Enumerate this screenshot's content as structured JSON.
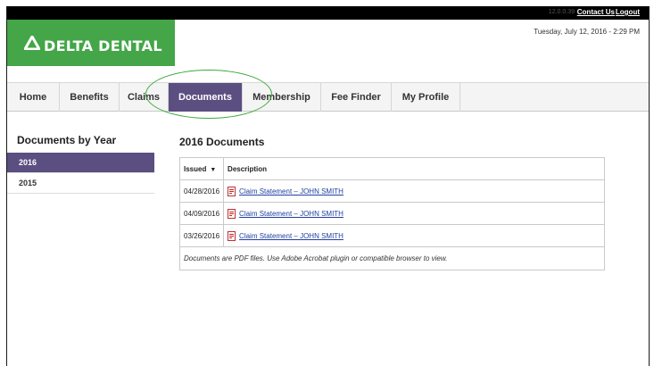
{
  "topbar": {
    "version": "12.0.0.39",
    "contact_label": "Contact Us",
    "logout_label": "Logout"
  },
  "header": {
    "logo_text": "DELTA DENTAL",
    "datetime": "Tuesday, July 12, 2016 - 2:29 PM",
    "brand_color": "#44a648"
  },
  "nav": {
    "tabs": [
      {
        "label": "Home"
      },
      {
        "label": "Benefits"
      },
      {
        "label": "Claims"
      },
      {
        "label": "Documents"
      },
      {
        "label": "Membership"
      },
      {
        "label": "Fee Finder"
      },
      {
        "label": "My Profile"
      }
    ],
    "active_tab": "Documents",
    "accent_color": "#5b4e80"
  },
  "sidebar": {
    "title": "Documents by Year",
    "years": [
      {
        "label": "2016",
        "active": true
      },
      {
        "label": "2015",
        "active": false
      }
    ]
  },
  "main": {
    "title": "2016 Documents",
    "columns": {
      "issued": "Issued",
      "description": "Description"
    },
    "rows": [
      {
        "date": "04/28/2016",
        "description": "Claim Statement – JOHN SMITH",
        "icon": "pdf-icon"
      },
      {
        "date": "04/09/2016",
        "description": "Claim Statement – JOHN SMITH",
        "icon": "pdf-icon"
      },
      {
        "date": "03/26/2016",
        "description": "Claim Statement – JOHN SMITH",
        "icon": "pdf-icon"
      }
    ],
    "note": "Documents are PDF files. Use Adobe Acrobat plugin or compatible browser to view."
  }
}
